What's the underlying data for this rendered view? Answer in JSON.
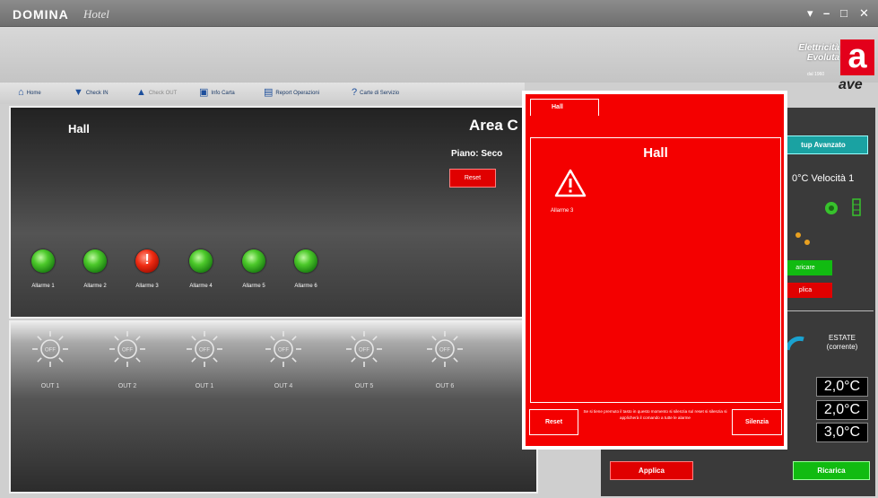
{
  "window": {
    "app_name": "DOMINA",
    "app_subname": "Hotel",
    "controls": [
      "▾",
      "–",
      "□",
      "✕"
    ]
  },
  "brand": {
    "line1": "Elettricità",
    "line2": "Evoluta",
    "since": "dal 1960",
    "logo_letter": "a",
    "logo_word": "ave",
    "color": "#e3001b"
  },
  "toolbar": {
    "items": [
      {
        "label": "Home",
        "icon": "home-icon",
        "enabled": true
      },
      {
        "label": "Check IN",
        "icon": "arrow-down-icon",
        "enabled": true
      },
      {
        "label": "Check OUT",
        "icon": "arrow-up-icon",
        "enabled": false
      },
      {
        "label": "Info Carta",
        "icon": "card-icon",
        "enabled": true
      },
      {
        "label": "Report Operazioni",
        "icon": "report-icon",
        "enabled": true
      },
      {
        "label": "Carte di Servizio",
        "icon": "question-icon",
        "enabled": true
      }
    ]
  },
  "hall": {
    "title": "Hall",
    "area_title": "Area C",
    "piano": "Piano: Seco",
    "reset_label": "Reset",
    "alarms": [
      {
        "label": "Allarme 1",
        "state": "ok"
      },
      {
        "label": "Allarme 2",
        "state": "ok"
      },
      {
        "label": "Allarme 3",
        "state": "alarm"
      },
      {
        "label": "Allarme 4",
        "state": "ok"
      },
      {
        "label": "Allarme 5",
        "state": "ok"
      },
      {
        "label": "Allarme 6",
        "state": "ok"
      }
    ]
  },
  "outputs": {
    "bulb_text": "OFF",
    "items": [
      {
        "label": "OUT 1"
      },
      {
        "label": "OUT 2"
      },
      {
        "label": "OUT 1"
      },
      {
        "label": "OUT 4"
      },
      {
        "label": "OUT 5"
      },
      {
        "label": "OUT 6"
      }
    ]
  },
  "right_panel": {
    "setup_label": "tup Avanzato",
    "speed_text": "0°C Velocità 1",
    "ricarica_small": "aricare",
    "applica_small": "plica",
    "estate_line1": "ESTATE",
    "estate_line2": "(corrente)",
    "temps": [
      "2,0°C",
      "2,0°C",
      "3,0°C"
    ],
    "applica_label": "Applica",
    "ricarica_label": "Ricarica"
  },
  "popup": {
    "tab_label": "Hall",
    "title": "Hall",
    "alarm_label": "Allarme 3",
    "reset_label": "Reset",
    "silenzia_label": "Silenzia",
    "message": "Se si tiene premuto il tasto in questo momento si silenzia sul reset si silenzia si applicherà il comando a tutte le alarme"
  },
  "colors": {
    "alarm_red": "#f40000",
    "ok_green": "#4cc92a",
    "teal": "#1aa2a2"
  }
}
